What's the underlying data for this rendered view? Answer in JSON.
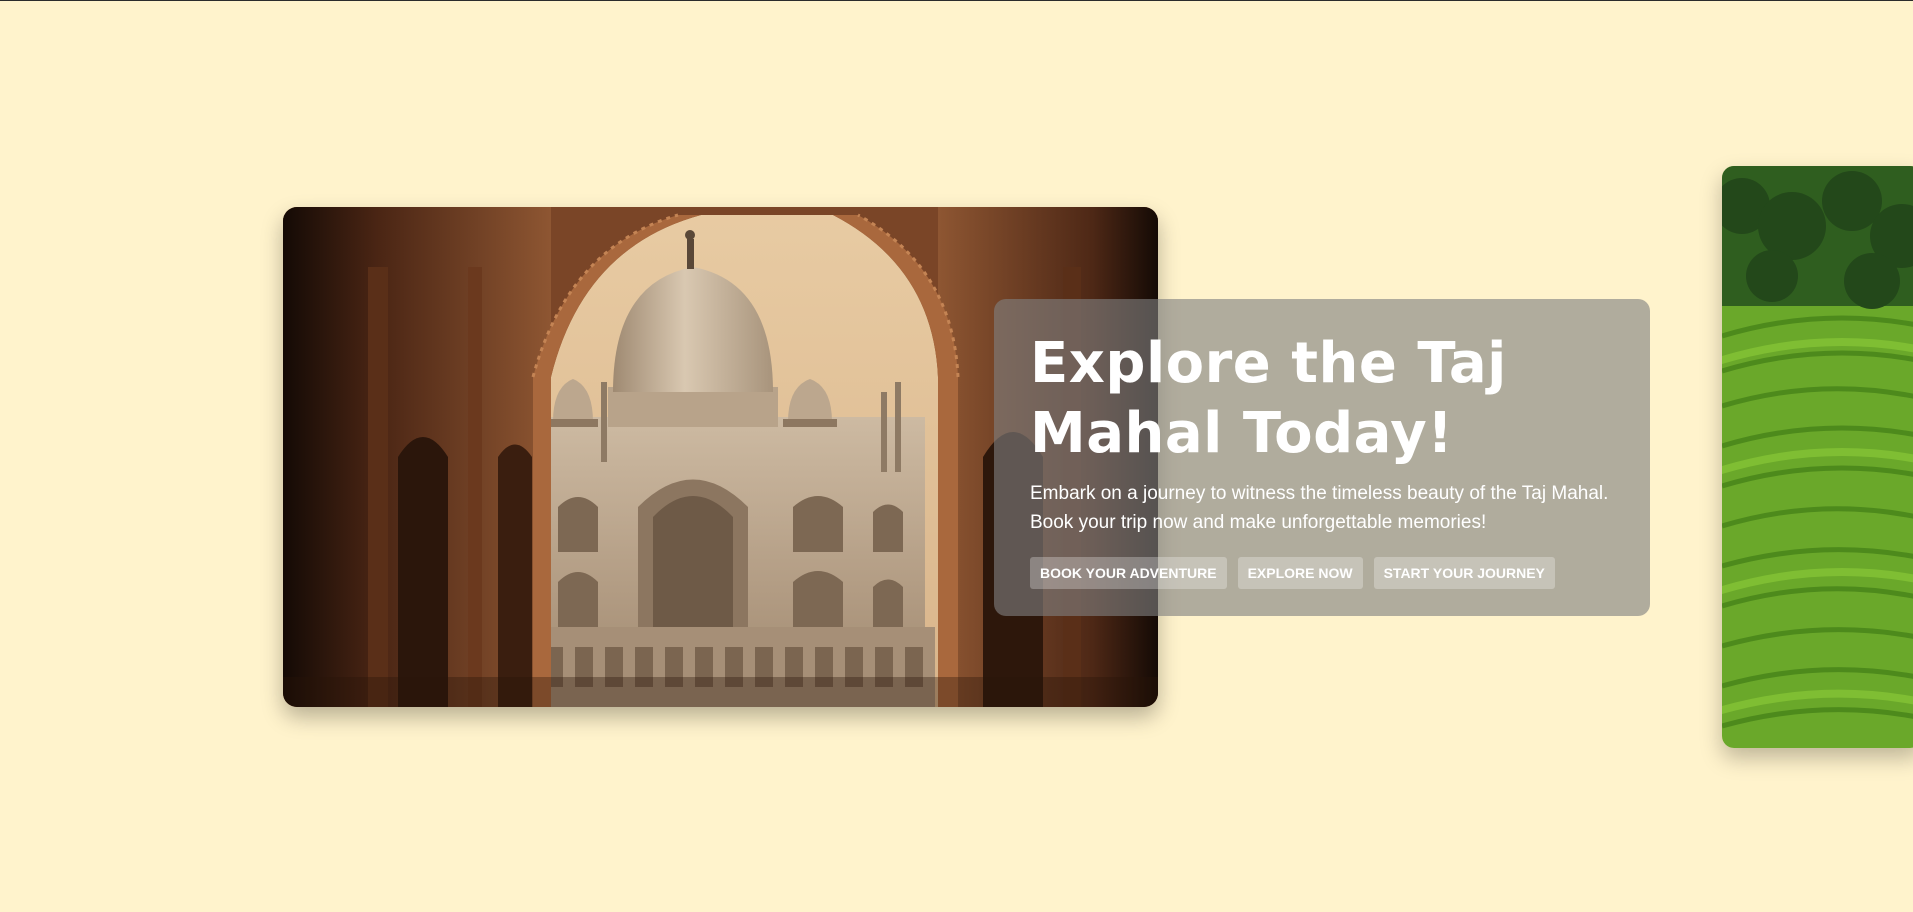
{
  "hero": {
    "title": "Explore the Taj Mahal Today!",
    "subtitle": "Embark on a journey to witness the timeless beauty of the Taj Mahal. Book your trip now and make unforgettable memories!",
    "buttons": [
      {
        "label": "BOOK YOUR ADVENTURE"
      },
      {
        "label": "EXPLORE NOW"
      },
      {
        "label": "START YOUR JOURNEY"
      }
    ]
  },
  "images": {
    "main": "taj-mahal-arch-photo",
    "next": "rice-terraces-photo"
  },
  "colors": {
    "background": "#fff3cc",
    "panel": "rgba(128,128,128,0.62)",
    "text": "#ffffff"
  }
}
